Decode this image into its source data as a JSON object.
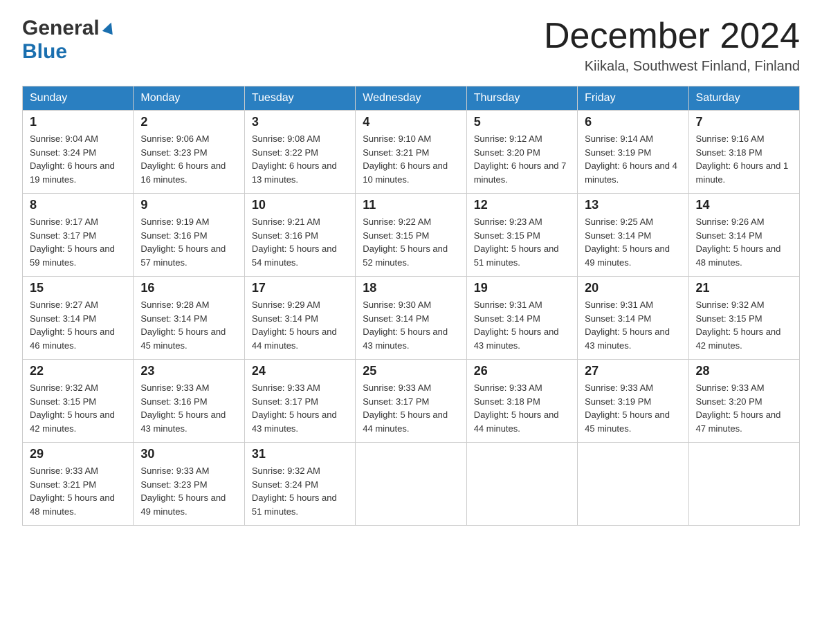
{
  "header": {
    "logo_general": "General",
    "logo_blue": "Blue",
    "month_title": "December 2024",
    "location": "Kiikala, Southwest Finland, Finland"
  },
  "weekdays": [
    "Sunday",
    "Monday",
    "Tuesday",
    "Wednesday",
    "Thursday",
    "Friday",
    "Saturday"
  ],
  "weeks": [
    [
      {
        "day": "1",
        "sunrise": "9:04 AM",
        "sunset": "3:24 PM",
        "daylight": "6 hours and 19 minutes."
      },
      {
        "day": "2",
        "sunrise": "9:06 AM",
        "sunset": "3:23 PM",
        "daylight": "6 hours and 16 minutes."
      },
      {
        "day": "3",
        "sunrise": "9:08 AM",
        "sunset": "3:22 PM",
        "daylight": "6 hours and 13 minutes."
      },
      {
        "day": "4",
        "sunrise": "9:10 AM",
        "sunset": "3:21 PM",
        "daylight": "6 hours and 10 minutes."
      },
      {
        "day": "5",
        "sunrise": "9:12 AM",
        "sunset": "3:20 PM",
        "daylight": "6 hours and 7 minutes."
      },
      {
        "day": "6",
        "sunrise": "9:14 AM",
        "sunset": "3:19 PM",
        "daylight": "6 hours and 4 minutes."
      },
      {
        "day": "7",
        "sunrise": "9:16 AM",
        "sunset": "3:18 PM",
        "daylight": "6 hours and 1 minute."
      }
    ],
    [
      {
        "day": "8",
        "sunrise": "9:17 AM",
        "sunset": "3:17 PM",
        "daylight": "5 hours and 59 minutes."
      },
      {
        "day": "9",
        "sunrise": "9:19 AM",
        "sunset": "3:16 PM",
        "daylight": "5 hours and 57 minutes."
      },
      {
        "day": "10",
        "sunrise": "9:21 AM",
        "sunset": "3:16 PM",
        "daylight": "5 hours and 54 minutes."
      },
      {
        "day": "11",
        "sunrise": "9:22 AM",
        "sunset": "3:15 PM",
        "daylight": "5 hours and 52 minutes."
      },
      {
        "day": "12",
        "sunrise": "9:23 AM",
        "sunset": "3:15 PM",
        "daylight": "5 hours and 51 minutes."
      },
      {
        "day": "13",
        "sunrise": "9:25 AM",
        "sunset": "3:14 PM",
        "daylight": "5 hours and 49 minutes."
      },
      {
        "day": "14",
        "sunrise": "9:26 AM",
        "sunset": "3:14 PM",
        "daylight": "5 hours and 48 minutes."
      }
    ],
    [
      {
        "day": "15",
        "sunrise": "9:27 AM",
        "sunset": "3:14 PM",
        "daylight": "5 hours and 46 minutes."
      },
      {
        "day": "16",
        "sunrise": "9:28 AM",
        "sunset": "3:14 PM",
        "daylight": "5 hours and 45 minutes."
      },
      {
        "day": "17",
        "sunrise": "9:29 AM",
        "sunset": "3:14 PM",
        "daylight": "5 hours and 44 minutes."
      },
      {
        "day": "18",
        "sunrise": "9:30 AM",
        "sunset": "3:14 PM",
        "daylight": "5 hours and 43 minutes."
      },
      {
        "day": "19",
        "sunrise": "9:31 AM",
        "sunset": "3:14 PM",
        "daylight": "5 hours and 43 minutes."
      },
      {
        "day": "20",
        "sunrise": "9:31 AM",
        "sunset": "3:14 PM",
        "daylight": "5 hours and 43 minutes."
      },
      {
        "day": "21",
        "sunrise": "9:32 AM",
        "sunset": "3:15 PM",
        "daylight": "5 hours and 42 minutes."
      }
    ],
    [
      {
        "day": "22",
        "sunrise": "9:32 AM",
        "sunset": "3:15 PM",
        "daylight": "5 hours and 42 minutes."
      },
      {
        "day": "23",
        "sunrise": "9:33 AM",
        "sunset": "3:16 PM",
        "daylight": "5 hours and 43 minutes."
      },
      {
        "day": "24",
        "sunrise": "9:33 AM",
        "sunset": "3:17 PM",
        "daylight": "5 hours and 43 minutes."
      },
      {
        "day": "25",
        "sunrise": "9:33 AM",
        "sunset": "3:17 PM",
        "daylight": "5 hours and 44 minutes."
      },
      {
        "day": "26",
        "sunrise": "9:33 AM",
        "sunset": "3:18 PM",
        "daylight": "5 hours and 44 minutes."
      },
      {
        "day": "27",
        "sunrise": "9:33 AM",
        "sunset": "3:19 PM",
        "daylight": "5 hours and 45 minutes."
      },
      {
        "day": "28",
        "sunrise": "9:33 AM",
        "sunset": "3:20 PM",
        "daylight": "5 hours and 47 minutes."
      }
    ],
    [
      {
        "day": "29",
        "sunrise": "9:33 AM",
        "sunset": "3:21 PM",
        "daylight": "5 hours and 48 minutes."
      },
      {
        "day": "30",
        "sunrise": "9:33 AM",
        "sunset": "3:23 PM",
        "daylight": "5 hours and 49 minutes."
      },
      {
        "day": "31",
        "sunrise": "9:32 AM",
        "sunset": "3:24 PM",
        "daylight": "5 hours and 51 minutes."
      },
      null,
      null,
      null,
      null
    ]
  ],
  "labels": {
    "sunrise_prefix": "Sunrise: ",
    "sunset_prefix": "Sunset: ",
    "daylight_prefix": "Daylight: "
  }
}
